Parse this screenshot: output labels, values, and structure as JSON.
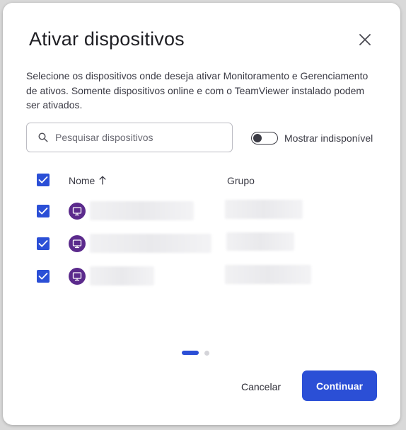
{
  "dialog": {
    "title": "Ativar dispositivos",
    "description": "Selecione os dispositivos onde deseja ativar Monitoramento e Gerenciamento de ativos. Somente dispositivos online e com o TeamViewer instalado podem ser ativados."
  },
  "search": {
    "placeholder": "Pesquisar dispositivos",
    "value": ""
  },
  "toggle": {
    "label": "Mostrar indisponível",
    "on": false
  },
  "table": {
    "columns": [
      "Nome",
      "Grupo"
    ],
    "sort_indicator": "↑",
    "select_all_checked": true,
    "rows": [
      {
        "checked": true,
        "icon": "monitor-icon"
      },
      {
        "checked": true,
        "icon": "monitor-icon"
      },
      {
        "checked": true,
        "icon": "monitor-icon"
      }
    ]
  },
  "pagination": {
    "current_step": 1,
    "total_steps": 2
  },
  "buttons": {
    "cancel": "Cancelar",
    "continue": "Continuar"
  },
  "colors": {
    "accent": "#2b4fd6",
    "device_icon": "#5b2a8c"
  }
}
